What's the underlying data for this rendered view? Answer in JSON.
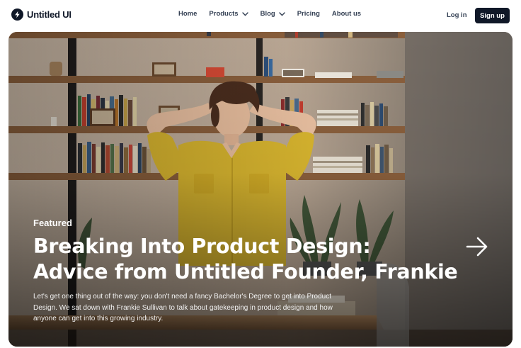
{
  "brand": {
    "name": "Untitled UI",
    "logo_icon": "lightning-bolt-icon"
  },
  "nav": {
    "items": [
      {
        "label": "Home",
        "has_dropdown": false
      },
      {
        "label": "Products",
        "has_dropdown": true
      },
      {
        "label": "Blog",
        "has_dropdown": true
      },
      {
        "label": "Pricing",
        "has_dropdown": false
      },
      {
        "label": "About us",
        "has_dropdown": false
      }
    ]
  },
  "actions": {
    "login_label": "Log in",
    "signup_label": "Sign up"
  },
  "hero": {
    "tag": "Featured",
    "headline_line1": "Breaking Into Product Design:",
    "headline_line2": "Advice from Untitled Founder, Frankie",
    "excerpt": "Let's get one thing out of the way: you don't need a fancy Bachelor's Degree to get into Product Design. We sat down with Frankie Sullivan to talk about gatekeeping in product design and how anyone can get into this growing industry.",
    "arrow_icon": "arrow-right-icon"
  },
  "colors": {
    "text_primary": "#101828",
    "nav_text": "#344054",
    "button_dark": "#101828",
    "shirt_yellow": "#d8b52f",
    "shelf_wood": "#8a5f3c"
  }
}
